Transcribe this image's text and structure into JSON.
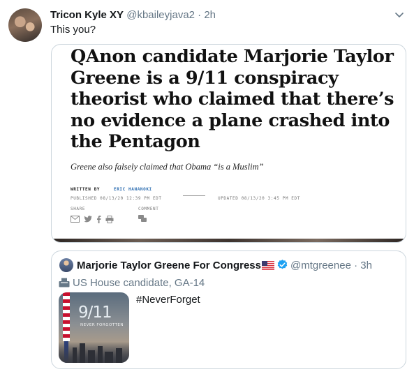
{
  "tweet": {
    "author_name": "Tricon Kyle XY",
    "handle": "@kbaileyjava2",
    "separator": "·",
    "time": "2h",
    "text": "This you?"
  },
  "article": {
    "headline": "QAnon candidate Marjorie Taylor Greene is a 9/11 conspiracy theorist who claimed that there’s no evidence a plane crashed into the Pentagon",
    "subhead": "Greene also falsely claimed that Obama “is a Muslim”",
    "written_by_label": "WRITTEN BY",
    "author": "ERIC HANANOKI",
    "published": "PUBLISHED 08/13/20 12:39 PM EDT",
    "updated": "UPDATED 08/13/20 3:45 PM EDT",
    "share_label": "SHARE",
    "comment_label": "COMMENT"
  },
  "quoted": {
    "name": "Marjorie Taylor Greene For Congress",
    "handle": "@mtgreenee",
    "separator": "·",
    "time": "3h",
    "label": "US House candidate, GA-14",
    "text": "#NeverForget",
    "thumb_big": "9/11",
    "thumb_small": "NEVER FORGOTTEN"
  },
  "colors": {
    "secondary_text": "#657786",
    "border": "#ccd6dd",
    "verified": "#1da1f2",
    "link": "#2b6cb0"
  },
  "icons": [
    "chevron-down-icon",
    "verified-badge-icon",
    "us-flag-icon",
    "ballot-box-icon",
    "email-icon",
    "twitter-icon",
    "facebook-icon",
    "print-icon",
    "comment-icon"
  ]
}
